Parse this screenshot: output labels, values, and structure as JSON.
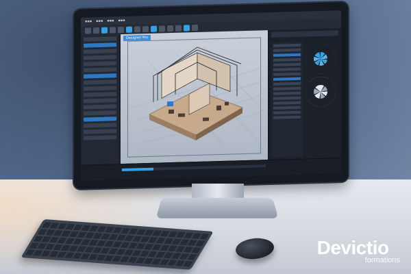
{
  "viewport": {
    "tab_label": "Designer Pro"
  },
  "watermark": {
    "name": "Devictio",
    "sub": "formations"
  },
  "timeline": {
    "progress_percent": 22
  },
  "colors": {
    "accent": "#3aa0e0",
    "selection": "#2f77c2"
  }
}
